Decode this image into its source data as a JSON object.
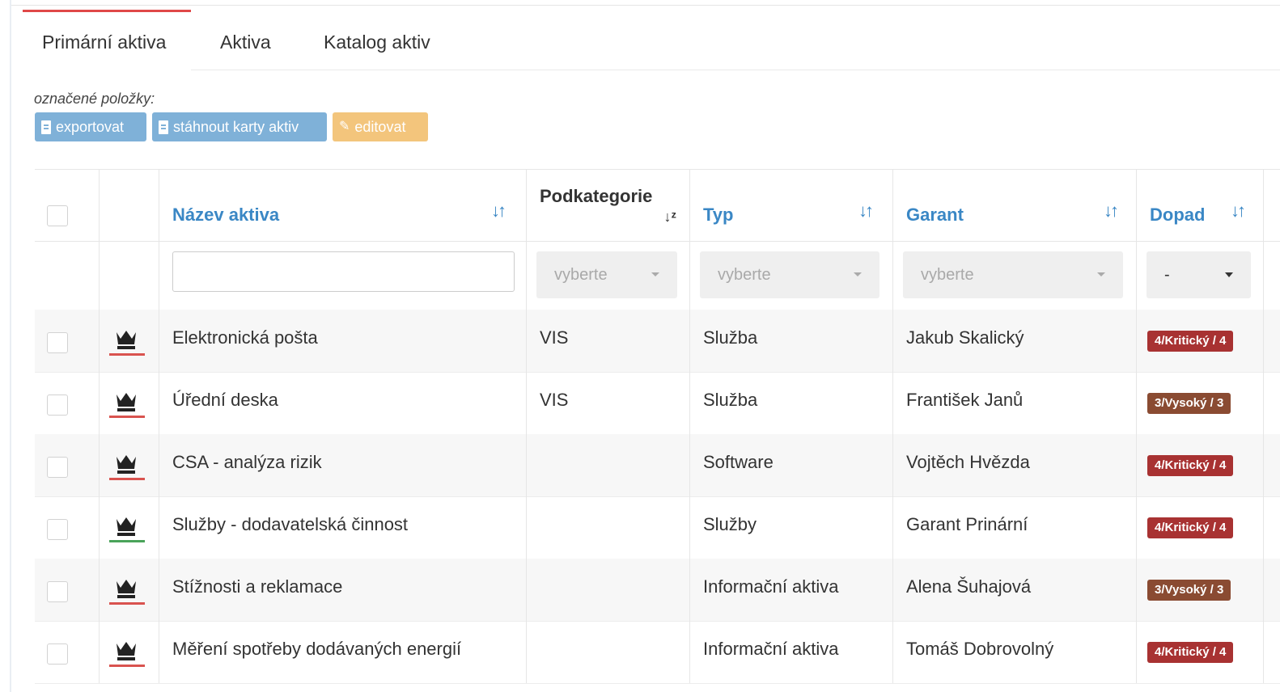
{
  "tabs": [
    {
      "label": "Primární aktiva",
      "active": true
    },
    {
      "label": "Aktiva",
      "active": false
    },
    {
      "label": "Katalog aktiv",
      "active": false
    }
  ],
  "selection": {
    "label": "označené položky:",
    "buttons": {
      "export": "exportovat",
      "cards": "stáhnout karty aktiv",
      "edit": "editovat"
    }
  },
  "table": {
    "headers": {
      "name": "Název aktiva",
      "subcategory": "Podkategorie",
      "type": "Typ",
      "guarantor": "Garant",
      "impact": "Dopad"
    },
    "filters": {
      "subcategory": "vyberte",
      "type": "vyberte",
      "guarantor": "vyberte",
      "impact": "-"
    },
    "rows": [
      {
        "name": "Elektronická pošta",
        "subcategory": "VIS",
        "type": "Služba",
        "guarantor": "Jakub Skalický",
        "impact": "4/Kritický / 4",
        "impact_color": "#a83232",
        "underline_color": "#d9534f"
      },
      {
        "name": "Úřední deska",
        "subcategory": "VIS",
        "type": "Služba",
        "guarantor": "František Janů",
        "impact": "3/Vysoký / 3",
        "impact_color": "#8a4b32",
        "underline_color": "#d9534f"
      },
      {
        "name": "CSA - analýza rizik",
        "subcategory": "",
        "type": "Software",
        "guarantor": "Vojtěch Hvězda",
        "impact": "4/Kritický / 4",
        "impact_color": "#a83232",
        "underline_color": "#d9534f"
      },
      {
        "name": "Služby - dodavatelská činnost",
        "subcategory": "",
        "type": "Služby",
        "guarantor": "Garant Prinární",
        "impact": "4/Kritický / 4",
        "impact_color": "#a83232",
        "underline_color": "#4aa35a"
      },
      {
        "name": "Stížnosti a reklamace",
        "subcategory": "",
        "type": "Informační aktiva",
        "guarantor": "Alena Šuhajová",
        "impact": "3/Vysoký / 3",
        "impact_color": "#8a4b32",
        "underline_color": "#d9534f"
      },
      {
        "name": "Měření spotřeby dodávaných energií",
        "subcategory": "",
        "type": "Informační aktiva",
        "guarantor": "Tomáš Dobrovolný",
        "impact": "4/Kritický / 4",
        "impact_color": "#a83232",
        "underline_color": "#d9534f"
      }
    ]
  },
  "icons": {
    "row_icon": "crown-icon",
    "sort": "sort-icon",
    "sort_alpha": "sort-alpha-icon",
    "document": "document-icon",
    "pencil": "pencil-icon"
  }
}
